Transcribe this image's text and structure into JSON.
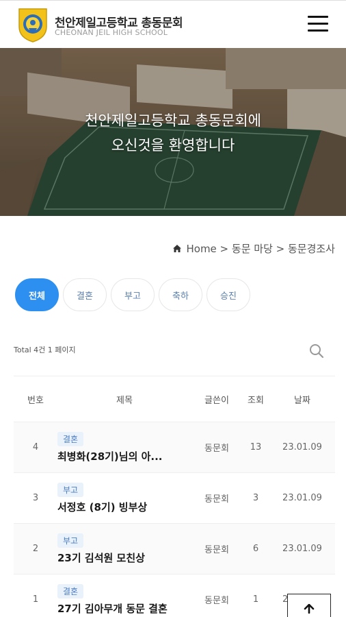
{
  "header": {
    "school_name": "천안제일고등학교 총동문회",
    "school_name_en": "CHEONAN JEIL HIGH SCHOOL"
  },
  "hero": {
    "line1": "천안제일고등학교 총동문회에",
    "line2": "오신것을 환영합니다"
  },
  "breadcrumb": {
    "home": "Home >",
    "section": "동문 마당",
    "sep": " > ",
    "page": "동문경조사"
  },
  "tabs": [
    {
      "label": "전체",
      "active": true
    },
    {
      "label": "결혼",
      "active": false
    },
    {
      "label": "부고",
      "active": false
    },
    {
      "label": "축하",
      "active": false
    },
    {
      "label": "승진",
      "active": false
    }
  ],
  "total_text": "Total 4건 1 페이지",
  "table": {
    "headers": {
      "no": "번호",
      "title": "제목",
      "author": "글쓴이",
      "views": "조회",
      "date": "날짜"
    },
    "rows": [
      {
        "no": "4",
        "category": "결혼",
        "title": "최병화(28기)님의 아...",
        "author": "동문회",
        "views": "13",
        "date": "23.01.09"
      },
      {
        "no": "3",
        "category": "부고",
        "title": "서정호 (8기) 빙부상",
        "author": "동문회",
        "views": "3",
        "date": "23.01.09"
      },
      {
        "no": "2",
        "category": "부고",
        "title": "23기 김석원 모친상",
        "author": "동문회",
        "views": "6",
        "date": "23.01.09"
      },
      {
        "no": "1",
        "category": "결혼",
        "title": "27기 김아무개 동문 결혼",
        "author": "동문회",
        "views": "1",
        "date": "23.01.09"
      }
    ]
  },
  "colors": {
    "accent": "#2d8ff0",
    "badge_text": "#4a7cc0",
    "badge_bg": "#e9f1fb"
  },
  "icons": {
    "logo": "school-emblem-icon",
    "menu": "hamburger-menu-icon",
    "home": "home-icon",
    "search": "search-icon",
    "top": "arrow-up-icon"
  }
}
